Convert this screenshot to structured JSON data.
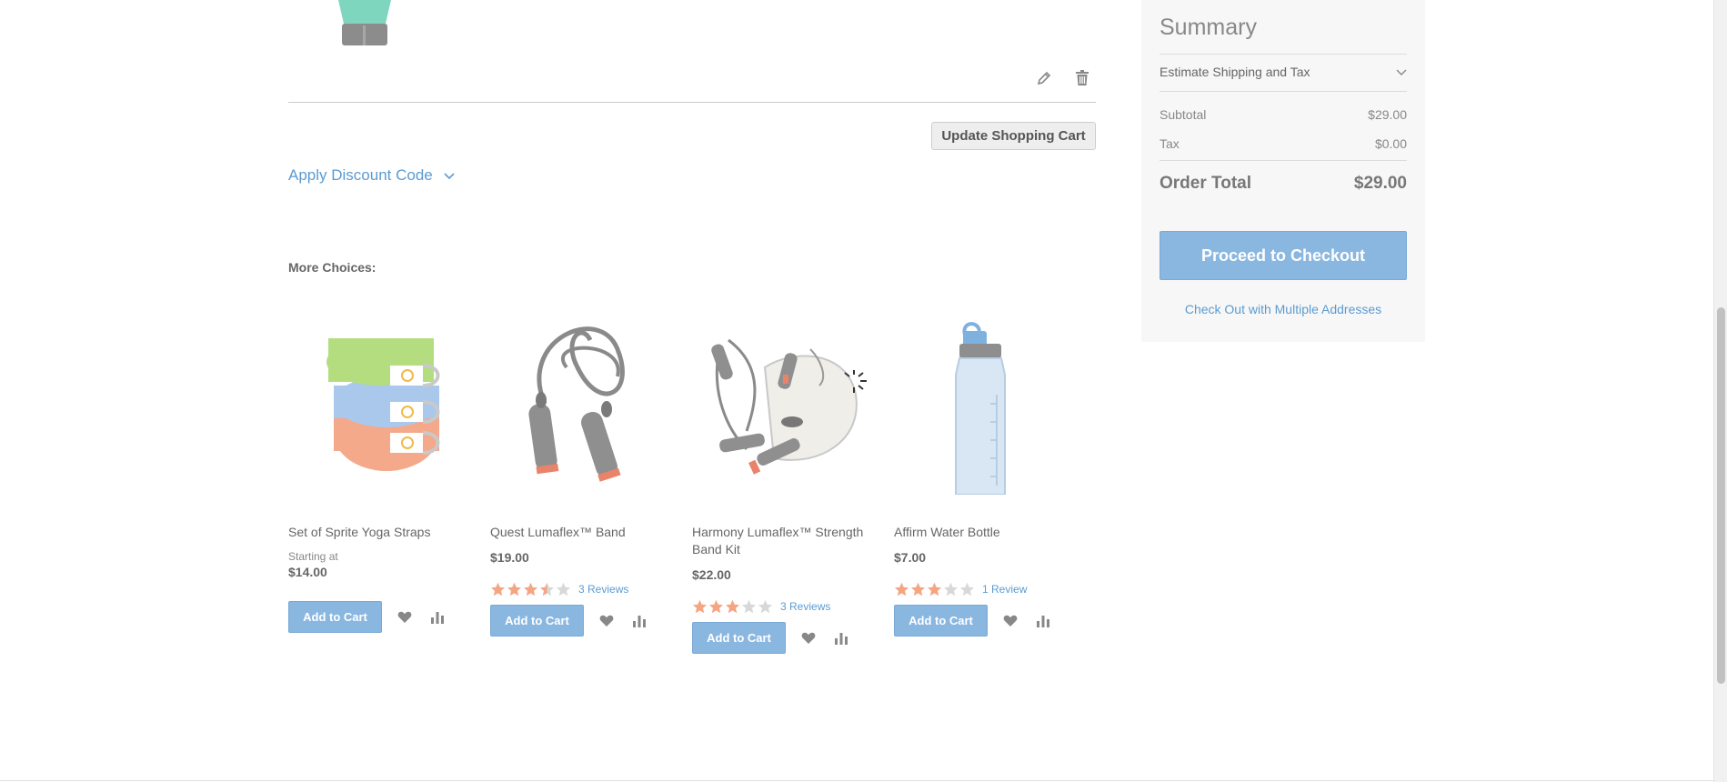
{
  "cart": {
    "edit_icon": "pencil-icon",
    "delete_icon": "trash-icon",
    "update_label": "Update Shopping Cart",
    "discount_label": "Apply Discount Code"
  },
  "more_choices": {
    "heading": "More Choices:",
    "products": [
      {
        "name": "Set of Sprite Yoga Straps",
        "starting_label": "Starting at",
        "price": "$14.00",
        "add_label": "Add to Cart"
      },
      {
        "name": "Quest Lumaflex™ Band",
        "price": "$19.00",
        "rating": 3.5,
        "reviews": "3 Reviews",
        "add_label": "Add to Cart"
      },
      {
        "name": "Harmony Lumaflex™ Strength Band Kit",
        "price": "$22.00",
        "rating": 3,
        "reviews": "3 Reviews",
        "add_label": "Add to Cart"
      },
      {
        "name": "Affirm Water Bottle",
        "price": "$7.00",
        "rating": 3,
        "reviews": "1 Review",
        "add_label": "Add to Cart"
      }
    ]
  },
  "summary": {
    "title": "Summary",
    "shipping_label": "Estimate Shipping and Tax",
    "subtotal_label": "Subtotal",
    "subtotal_value": "$29.00",
    "tax_label": "Tax",
    "tax_value": "$0.00",
    "total_label": "Order Total",
    "total_value": "$29.00",
    "checkout_label": "Proceed to Checkout",
    "multi_label": "Check Out with Multiple Addresses"
  },
  "colors": {
    "accent": "#8ab7e0",
    "link": "#5b9bd1",
    "star_filled": "#f4a582",
    "star_empty": "#d8d8d8"
  }
}
